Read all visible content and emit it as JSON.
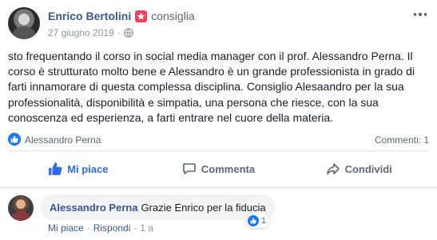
{
  "post": {
    "author": "Enrico Bertolini",
    "action": "consiglia",
    "date": "27 giugno 2019",
    "dot": "·",
    "text": "sto frequentando il corso in social media manager con il prof. Alessandro Perna. Il corso è strutturato molto bene e Alessandro è un grande professionista in grado di farti innamorare di questa complessa disciplina. Consiglio Alesaandro per la sua professionalità, disponibilità e simpatia, una persona che riesce, con la sua conoscenza ed esperienza, a farti entrare nel cuore della materia."
  },
  "reactions": {
    "names": "Alessandro Perna",
    "comments": "Commenti: 1"
  },
  "actions": {
    "like": "Mi piace",
    "comment": "Commenta",
    "share": "Condividi"
  },
  "comment": {
    "author": "Alessandro Perna",
    "text": "Grazie Enrico per la fiducia",
    "like_count": "1",
    "like_label": "Mi piace",
    "reply_label": "Rispondi",
    "time": "1 a",
    "sep": "·"
  },
  "colors": {
    "accent_blue": "#1877f2",
    "link_blue": "#365899",
    "recommend_red": "#f3425f"
  },
  "icons": {
    "recommend": "recommend-star-icon",
    "privacy": "globe-icon",
    "more": "more-options-icon",
    "like": "thumbs-up-icon",
    "comment": "comment-bubble-icon",
    "share": "share-arrow-icon"
  }
}
